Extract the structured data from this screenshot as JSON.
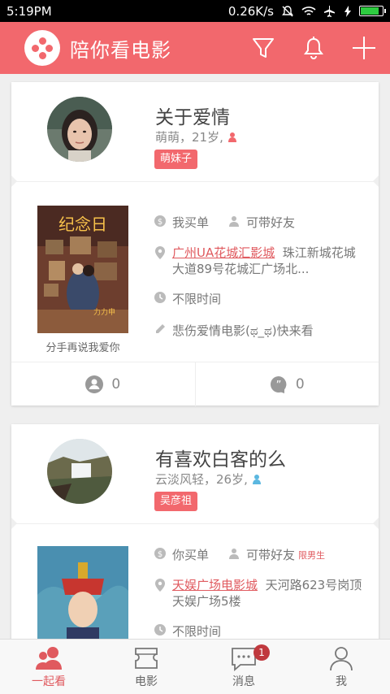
{
  "status": {
    "time": "5:19PM",
    "speed": "0.26K/s"
  },
  "app": {
    "title": "陪你看电影"
  },
  "posts": [
    {
      "title": "关于爱情",
      "meta": "萌萌，21岁,",
      "tag": "萌妹子",
      "buy": "我买单",
      "friend": "可带好友",
      "cinema": "广州UA花城汇影城",
      "address": "珠江新城花城大道89号花城汇广场北...",
      "time": "不限时间",
      "note": "悲伤爱情电影(ಥ_ಥ)快来看",
      "poster_caption": "分手再说我爱你",
      "poster_title": "纪念日",
      "likes": "0",
      "comments": "0"
    },
    {
      "title": "有喜欢白客的么",
      "meta": "云淡风轻，26岁,",
      "tag": "吴彦祖",
      "buy": "你买单",
      "friend": "可带好友",
      "friend_limit": "限男生",
      "cinema": "天娱广场电影城",
      "address": "天河路623号岗顶天娱广场5楼",
      "time": "不限时间"
    }
  ],
  "nav": [
    {
      "label": "一起看"
    },
    {
      "label": "电影"
    },
    {
      "label": "消息",
      "badge": "1"
    },
    {
      "label": "我"
    }
  ],
  "colors": {
    "brand": "#f2686d",
    "link": "#e05a5f"
  }
}
